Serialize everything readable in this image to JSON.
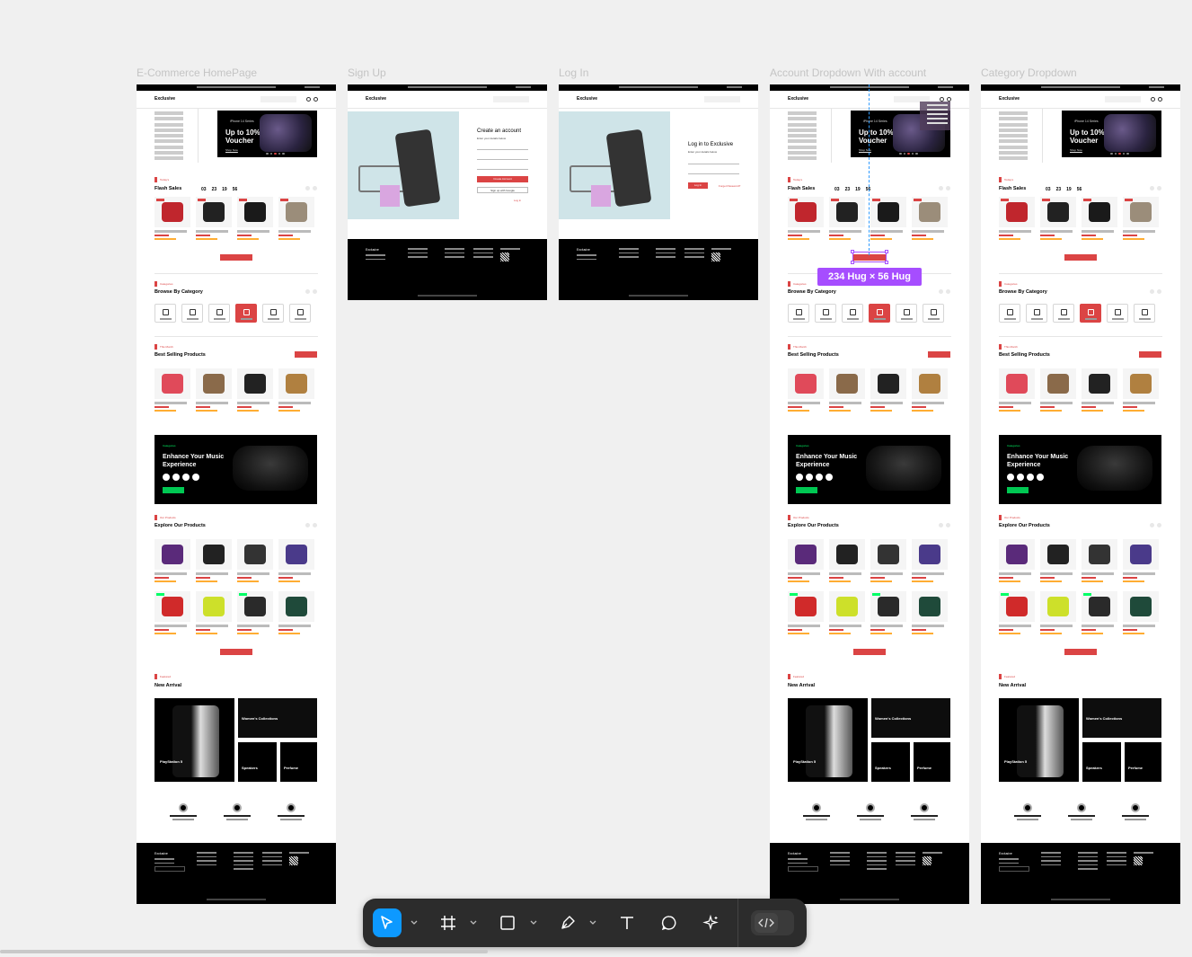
{
  "frames": [
    {
      "title": "E-Commerce HomePage"
    },
    {
      "title": "Sign Up"
    },
    {
      "title": "Log In"
    },
    {
      "title": "Account Dropdown With account"
    },
    {
      "title": "Category Dropdown"
    }
  ],
  "site": {
    "logo": "Exclusive",
    "hero_small": "iPhone 14 Series",
    "hero_title": "Up to 10% off Voucher",
    "hero_cta": "Shop Now",
    "flash_label": "Today's",
    "flash_title": "Flash Sales",
    "timer": [
      "03",
      "23",
      "19",
      "56"
    ],
    "categories_label": "Categories",
    "categories_title": "Browse By Category",
    "best_label": "This Month",
    "best_title": "Best Selling Products",
    "music_label": "Categories",
    "music_title": "Enhance Your Music Experience",
    "explore_label": "Our Products",
    "explore_title": "Explore Our Products",
    "arrival_label": "Featured",
    "arrival_title": "New Arrival",
    "arrival_ps": "PlayStation 5",
    "arrival_women": "Women's Collections",
    "arrival_speakers": "Speakers",
    "arrival_perfume": "Perfume",
    "footer_brand": "Exclusive"
  },
  "signup": {
    "title": "Create an account",
    "subtitle": "Enter your details below",
    "button": "Create Account",
    "google": "Sign up with Google",
    "login_link": "Log in"
  },
  "login": {
    "title": "Log in to Exclusive",
    "subtitle": "Enter your details below",
    "button": "Log In",
    "forgot": "Forget Password?"
  },
  "selection": {
    "size_badge": "234 Hug × 56 Hug"
  },
  "toolbar": {
    "tools": [
      "move-tool",
      "frame-tool",
      "rectangle-tool",
      "pen-tool",
      "text-tool",
      "comment-tool",
      "actions-tool"
    ],
    "active_tool": "move-tool",
    "accent": "#0d99ff"
  },
  "colors": {
    "brand_red": "#db4444",
    "green": "#00ff66",
    "selection_purple": "#a64dff",
    "canvas": "#f0f0f0"
  }
}
